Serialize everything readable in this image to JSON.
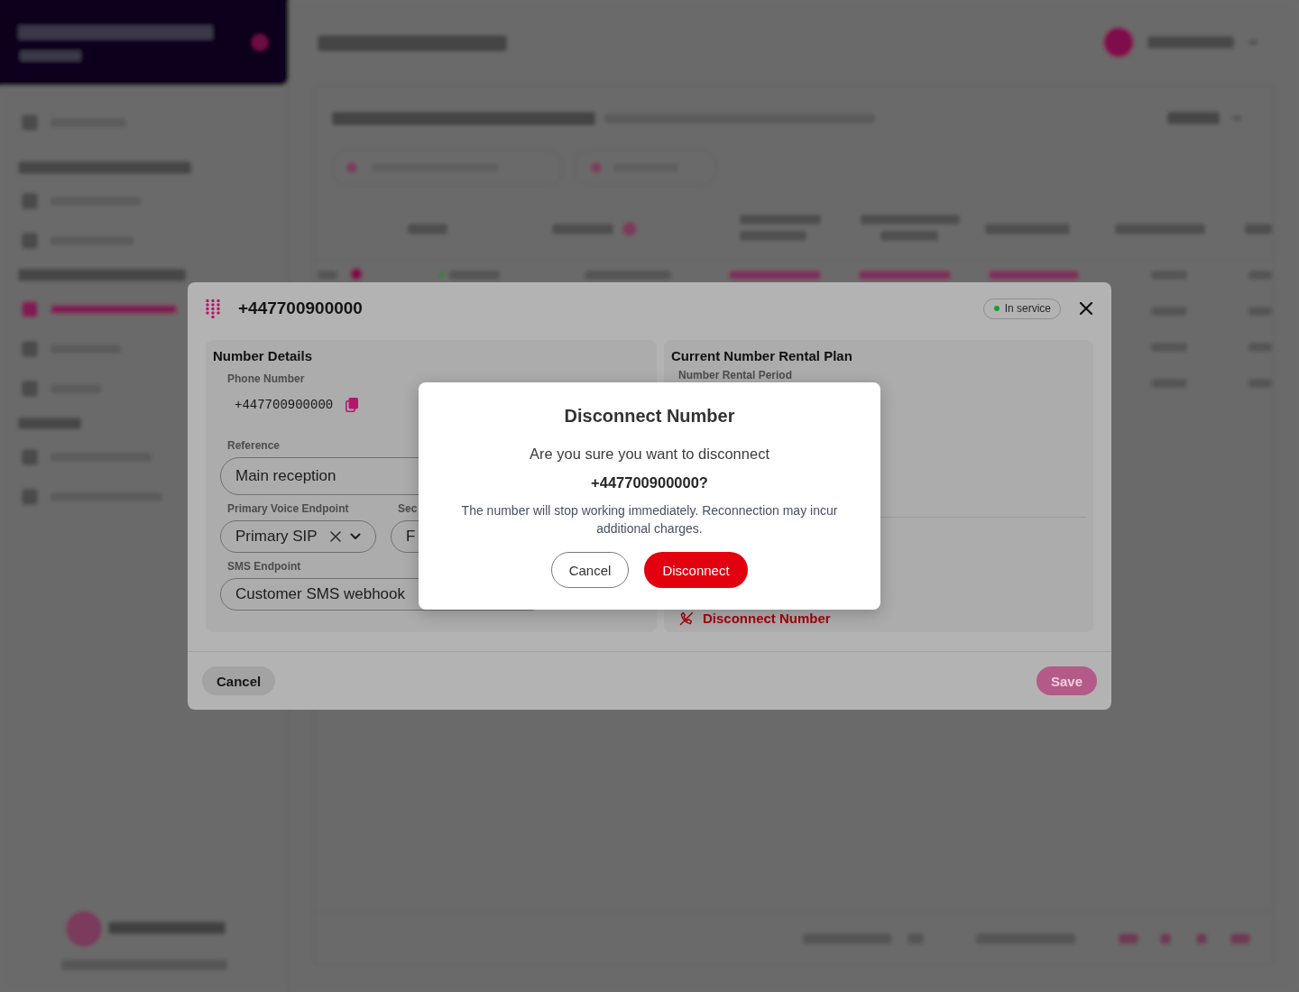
{
  "number_modal": {
    "title": "+447700900000",
    "status": {
      "label": "In service",
      "active": true
    },
    "number_details": {
      "heading": "Number Details",
      "phone_number": {
        "label": "Phone Number",
        "value": "+447700900000"
      },
      "reference": {
        "label": "Reference",
        "value": "Main reception"
      },
      "primary_voice_endpoint": {
        "label": "Primary Voice Endpoint",
        "value": "Primary SIP"
      },
      "field_4": {
        "label": "Sec",
        "value": "F"
      },
      "sms_endpoint": {
        "label": "SMS Endpoint",
        "value": "Customer SMS webhook"
      }
    },
    "rental_plan": {
      "heading": "Current Number Rental Plan",
      "period_label": "Number Rental Period",
      "disconnect_link": "Disconnect Number"
    },
    "footer_buttons": [
      {
        "label": "Cancel",
        "kind": "neutral"
      },
      {
        "label": "Save",
        "kind": "primary"
      }
    ]
  },
  "confirm_dialog": {
    "title": "Disconnect Number",
    "message": "Are you sure you want to disconnect",
    "number": "+447700900000?",
    "note": "The number will stop working immediately. Reconnection may incur additional charges.",
    "buttons": [
      {
        "label": "Cancel",
        "kind": "secondary"
      },
      {
        "label": "Disconnect",
        "kind": "danger"
      }
    ]
  }
}
